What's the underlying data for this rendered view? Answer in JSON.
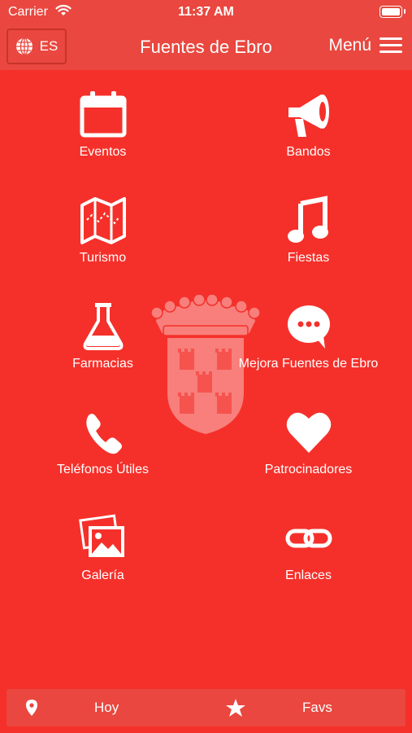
{
  "status": {
    "carrier": "Carrier",
    "time": "11:37 AM"
  },
  "header": {
    "lang": "ES",
    "title": "Fuentes de Ebro",
    "menu": "Menú"
  },
  "tiles": [
    {
      "label": "Eventos",
      "icon": "calendar-icon"
    },
    {
      "label": "Bandos",
      "icon": "megaphone-icon"
    },
    {
      "label": "Turismo",
      "icon": "map-icon"
    },
    {
      "label": "Fiestas",
      "icon": "music-note-icon"
    },
    {
      "label": "Farmacias",
      "icon": "flask-icon"
    },
    {
      "label": "Mejora Fuentes de Ebro",
      "icon": "chat-bubble-icon"
    },
    {
      "label": "Teléfonos Útiles",
      "icon": "phone-icon"
    },
    {
      "label": "Patrocinadores",
      "icon": "heart-icon"
    },
    {
      "label": "Galería",
      "icon": "gallery-icon"
    },
    {
      "label": "Enlaces",
      "icon": "link-icon"
    }
  ],
  "tabbar": {
    "today": "Hoy",
    "favs": "Favs"
  },
  "colors": {
    "background": "#f5302a",
    "bar": "#e9473f"
  }
}
